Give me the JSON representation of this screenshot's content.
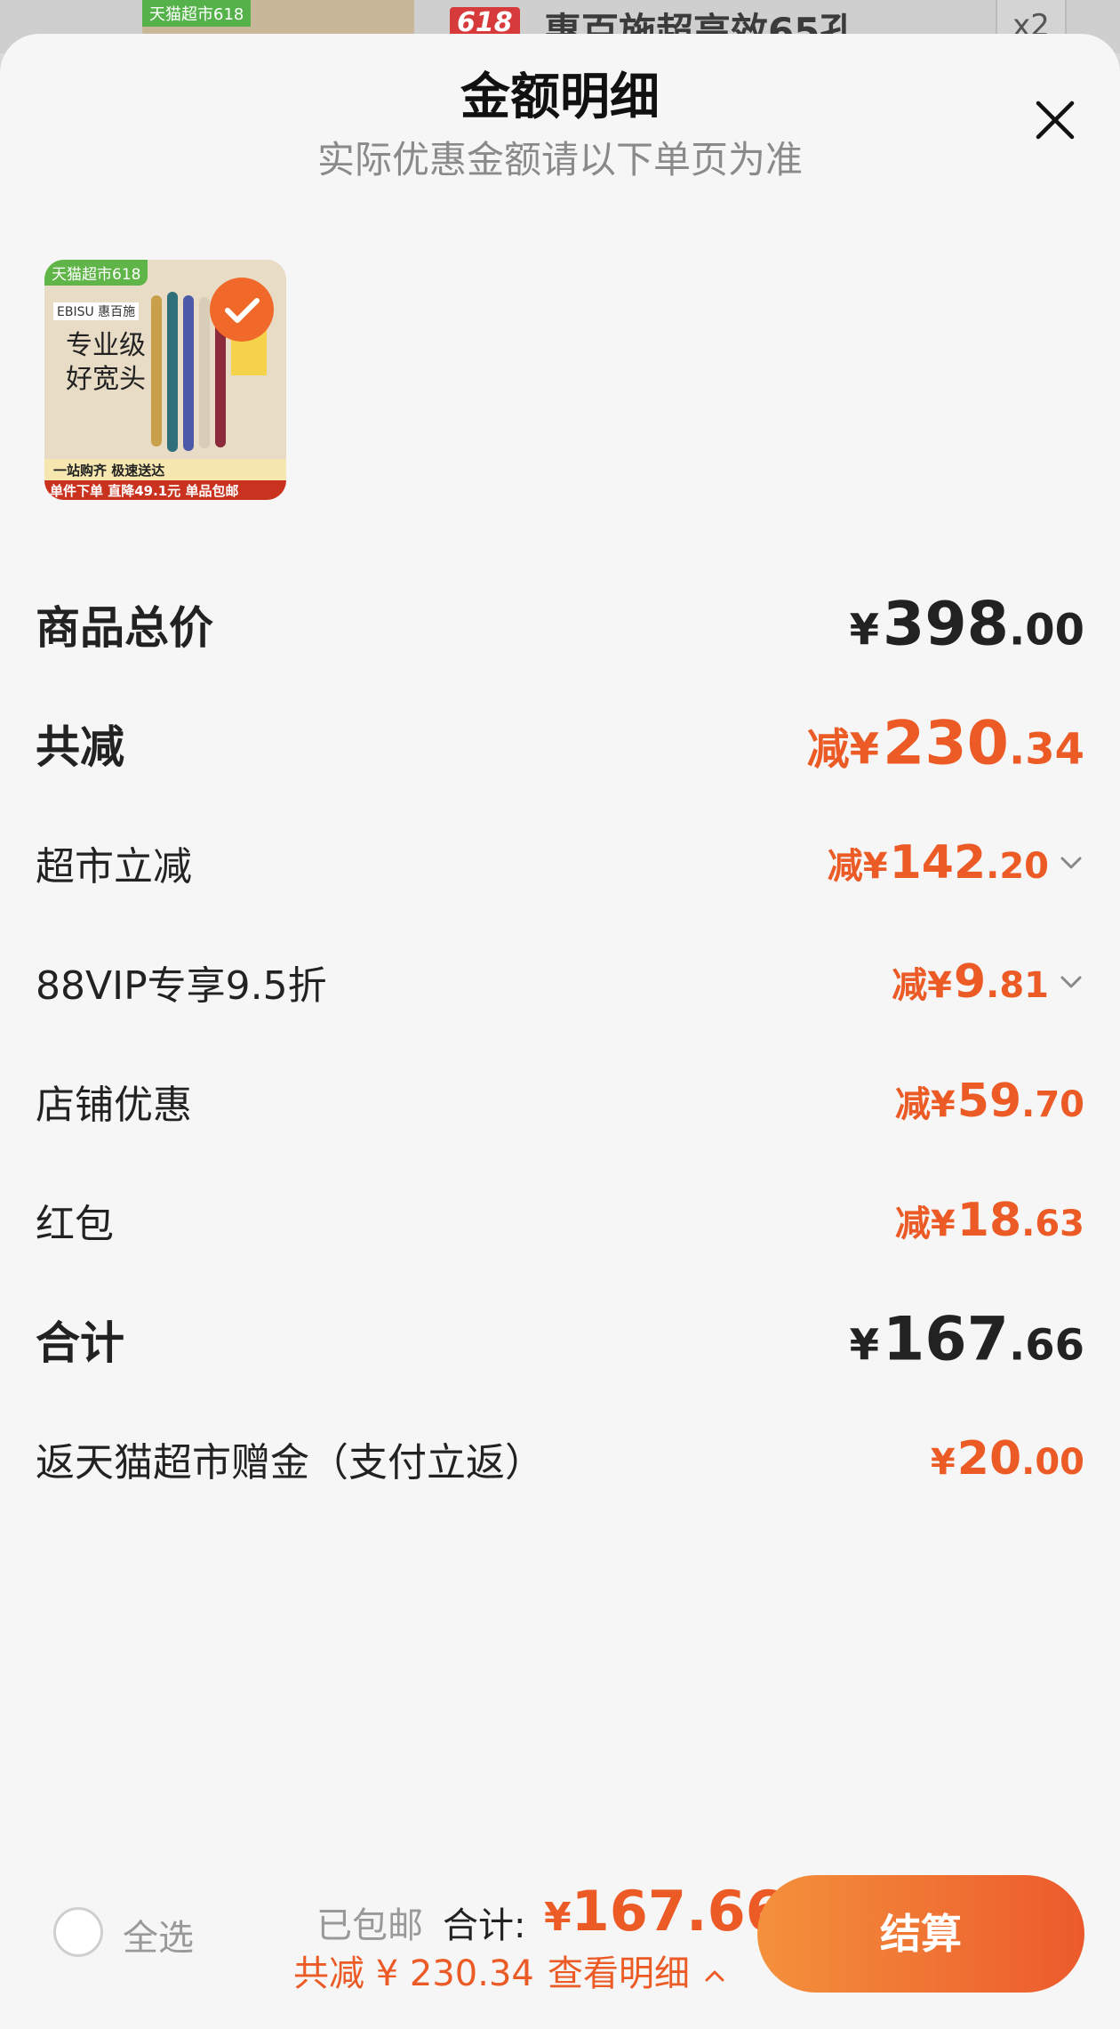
{
  "background": {
    "thumb_tag": "天猫超市618",
    "badge_618": "618",
    "product_title": "惠百施超高效65孔",
    "quantity": "x2"
  },
  "sheet": {
    "title": "金额明细",
    "subtitle": "实际优惠金额请以下单页为准"
  },
  "product_image": {
    "tag": "天猫超市618",
    "brand": "EBISU 惠百施",
    "headline_1": "专业级",
    "headline_2": "好宽头",
    "line_1": "一站购齐 极速送达",
    "line_2": "单件下单 直降49.1元 单品包邮",
    "selected": true
  },
  "rows": {
    "subtotal": {
      "label": "商品总价",
      "prefix": "¥",
      "int": "398",
      "dec": ".00"
    },
    "total_discount": {
      "label": "共减",
      "prefix": "减¥",
      "int": "230",
      "dec": ".34"
    },
    "supermarket": {
      "label": "超市立减",
      "prefix": "减¥",
      "int": "142",
      "dec": ".20"
    },
    "vip": {
      "label": "88VIP专享9.5折",
      "prefix": "减¥",
      "int": "9",
      "dec": ".81"
    },
    "store": {
      "label": "店铺优惠",
      "prefix": "减¥",
      "int": "59",
      "dec": ".70"
    },
    "redpacket": {
      "label": "红包",
      "prefix": "减¥",
      "int": "18",
      "dec": ".63"
    },
    "total": {
      "label": "合计",
      "prefix": "¥",
      "int": "167",
      "dec": ".66"
    },
    "rebate": {
      "label": "返天猫超市赠金（支付立返）",
      "prefix": "¥",
      "int": "20",
      "dec": ".00"
    }
  },
  "bottom": {
    "select_all": "全选",
    "shipped": "已包邮",
    "total_label": "合计:",
    "total_prefix": "¥",
    "total_value": "167.66",
    "saved_text": "共减 ¥ 230.34",
    "view_detail": "查看明细",
    "checkout": "结算"
  },
  "colors": {
    "accent": "#ec5b26",
    "text": "#222222",
    "muted": "#8a8a8a"
  },
  "icons": [
    "close-icon",
    "check-icon",
    "chevron-down-icon",
    "chevron-up-icon"
  ]
}
